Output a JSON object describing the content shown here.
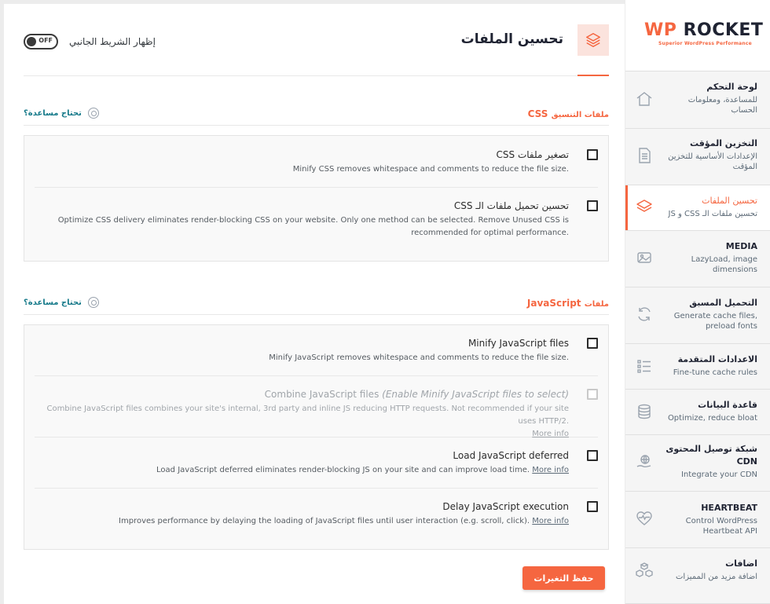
{
  "header": {
    "title": "تحسين الملفات",
    "sidebar_toggle_label": "إظهار الشريط الجانبي",
    "toggle_state": "OFF"
  },
  "sections": {
    "css": {
      "title_prefix": "ملفات التنسيق",
      "title_main": "CSS",
      "help": "تحتاج مساعدة؟",
      "options": [
        {
          "label": "تصغير ملفات CSS",
          "desc": "Minify CSS removes whitespace and comments to reduce the file size.",
          "checked": false
        },
        {
          "label": "تحسين تحميل ملفات الـ CSS",
          "desc": "Optimize CSS delivery eliminates render-blocking CSS on your website. Only one method can be selected. Remove Unused CSS is recommended for optimal performance.",
          "checked": false
        }
      ]
    },
    "js": {
      "title_prefix": "ملفات",
      "title_main": "JavaScript",
      "help": "تحتاج مساعدة؟",
      "options": [
        {
          "label": "Minify JavaScript files",
          "desc": "Minify JavaScript removes whitespace and comments to reduce the file size.",
          "checked": false,
          "disabled": false
        },
        {
          "label": "Combine JavaScript files",
          "label_hint": "(Enable Minify JavaScript files to select)",
          "desc": "Combine JavaScript files combines your site's internal, 3rd party and inline JS reducing HTTP requests. Not recommended if your site uses HTTP/2.",
          "more": "More info",
          "checked": false,
          "disabled": true
        },
        {
          "label": "Load JavaScript deferred",
          "desc": "Load JavaScript deferred eliminates render-blocking JS on your site and can improve load time.",
          "more": "More info",
          "checked": false,
          "disabled": false
        },
        {
          "label": "Delay JavaScript execution",
          "desc": "Improves performance by delaying the loading of JavaScript files until user interaction (e.g. scroll, click).",
          "more": "More info",
          "checked": false,
          "disabled": false
        }
      ]
    }
  },
  "save_label": "حفظ التغيرات",
  "brand": {
    "wp": "WP",
    "name": "ROCKET",
    "tagline": "Superior WordPress Performance"
  },
  "nav": [
    {
      "title": "لوحة التحكم",
      "sub": "للمساعدة، ومعلومات الحساب",
      "icon": "home-icon"
    },
    {
      "title": "التخزين المؤقت",
      "sub": "الإعدادات الأساسية للتخزين المؤقت",
      "icon": "document-icon"
    },
    {
      "title": "تحسين الملفات",
      "sub": "تحسين ملفات الـ CSS و JS",
      "icon": "layers-icon",
      "active": true
    },
    {
      "title": "MEDIA",
      "sub": "LazyLoad, image dimensions",
      "icon": "image-icon"
    },
    {
      "title": "التحميل المسبق",
      "sub": "Generate cache files, preload fonts",
      "icon": "refresh-icon"
    },
    {
      "title": "الاعدادات المتقدمة",
      "sub": "Fine-tune cache rules",
      "icon": "list-icon"
    },
    {
      "title": "قاعدة البيانات",
      "sub": "Optimize, reduce bloat",
      "icon": "database-icon"
    },
    {
      "title": "شبكة توصيل المحتوى CDN",
      "sub": "Integrate your CDN",
      "icon": "cdn-icon"
    },
    {
      "title": "HEARTBEAT",
      "sub": "Control WordPress Heartbeat API",
      "icon": "heartbeat-icon"
    },
    {
      "title": "اضافات",
      "sub": "اضافة مزيد من المميزات",
      "icon": "addons-icon"
    }
  ],
  "colors": {
    "accent": "#f56640",
    "link": "#167a8a",
    "text": "#32373c"
  }
}
